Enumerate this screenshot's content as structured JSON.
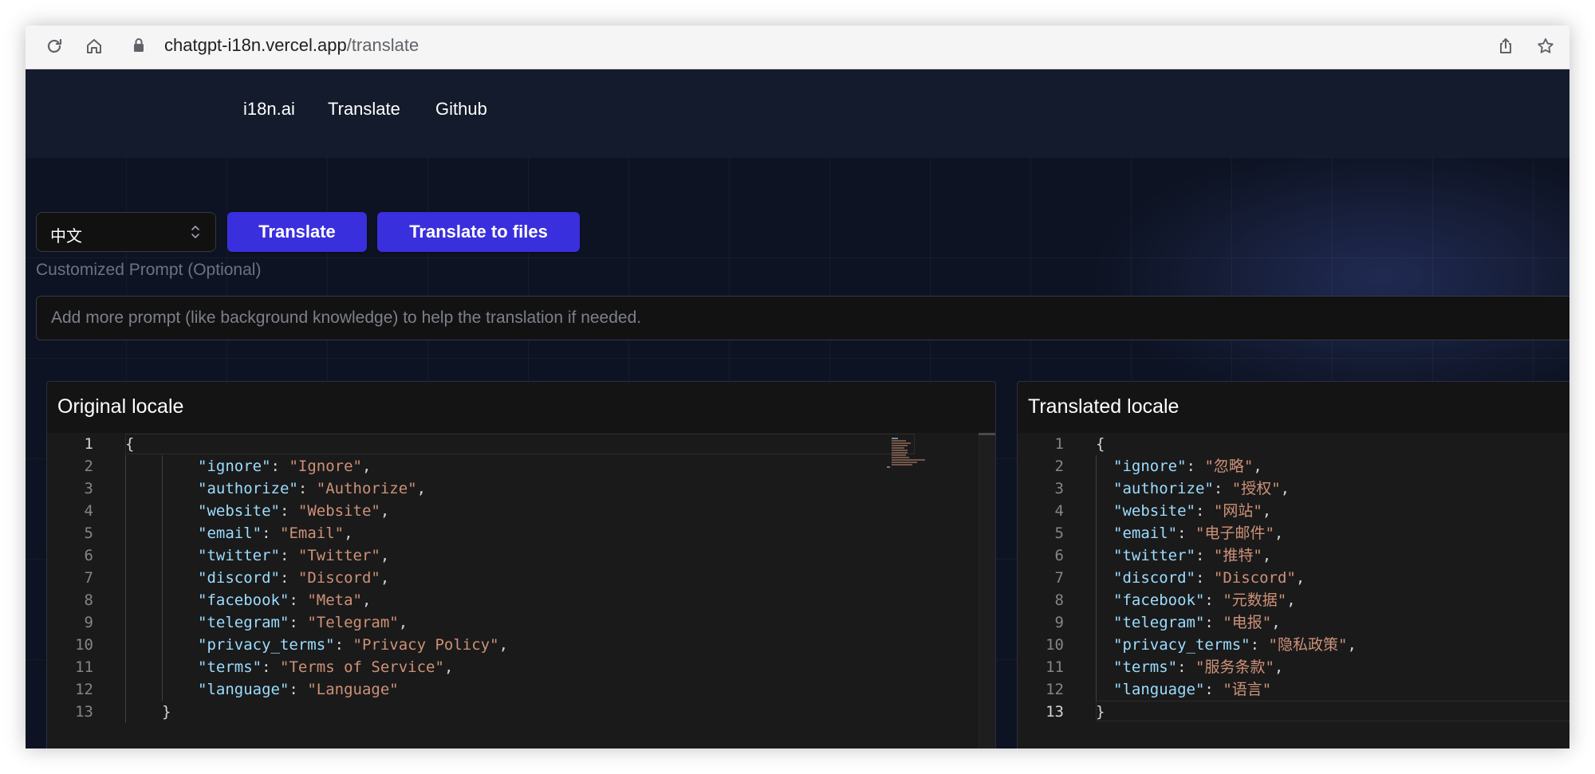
{
  "browser": {
    "url_host": "chatgpt-i18n.vercel.app",
    "url_path": "/translate",
    "icons": [
      "reload-icon",
      "home-icon",
      "lock-icon",
      "share-icon",
      "star-icon"
    ]
  },
  "nav": {
    "items": [
      "i18n.ai",
      "Translate",
      "Github"
    ]
  },
  "toolbar": {
    "language": "中文",
    "translate_label": "Translate",
    "translate_files_label": "Translate to files"
  },
  "prompt": {
    "label": "Customized Prompt (Optional)",
    "placeholder": "Add more prompt (like background knowledge) to help the translation if needed."
  },
  "original": {
    "title": "Original locale",
    "entries": [
      {
        "key": "ignore",
        "value": "Ignore"
      },
      {
        "key": "authorize",
        "value": "Authorize"
      },
      {
        "key": "website",
        "value": "Website"
      },
      {
        "key": "email",
        "value": "Email"
      },
      {
        "key": "twitter",
        "value": "Twitter"
      },
      {
        "key": "discord",
        "value": "Discord"
      },
      {
        "key": "facebook",
        "value": "Meta"
      },
      {
        "key": "telegram",
        "value": "Telegram"
      },
      {
        "key": "privacy_terms",
        "value": "Privacy Policy"
      },
      {
        "key": "terms",
        "value": "Terms of Service"
      },
      {
        "key": "language",
        "value": "Language"
      }
    ]
  },
  "translated": {
    "title": "Translated locale",
    "entries": [
      {
        "key": "ignore",
        "value": "忽略"
      },
      {
        "key": "authorize",
        "value": "授权"
      },
      {
        "key": "website",
        "value": "网站"
      },
      {
        "key": "email",
        "value": "电子邮件"
      },
      {
        "key": "twitter",
        "value": "推特"
      },
      {
        "key": "discord",
        "value": "Discord"
      },
      {
        "key": "facebook",
        "value": "元数据"
      },
      {
        "key": "telegram",
        "value": "电报"
      },
      {
        "key": "privacy_terms",
        "value": "隐私政策"
      },
      {
        "key": "terms",
        "value": "服务条款"
      },
      {
        "key": "language",
        "value": "语言"
      }
    ]
  },
  "colors": {
    "accent": "#3a2fdc",
    "json_key": "#9cdcfe",
    "json_string": "#ce9178",
    "page_bg": "#0d1322"
  }
}
